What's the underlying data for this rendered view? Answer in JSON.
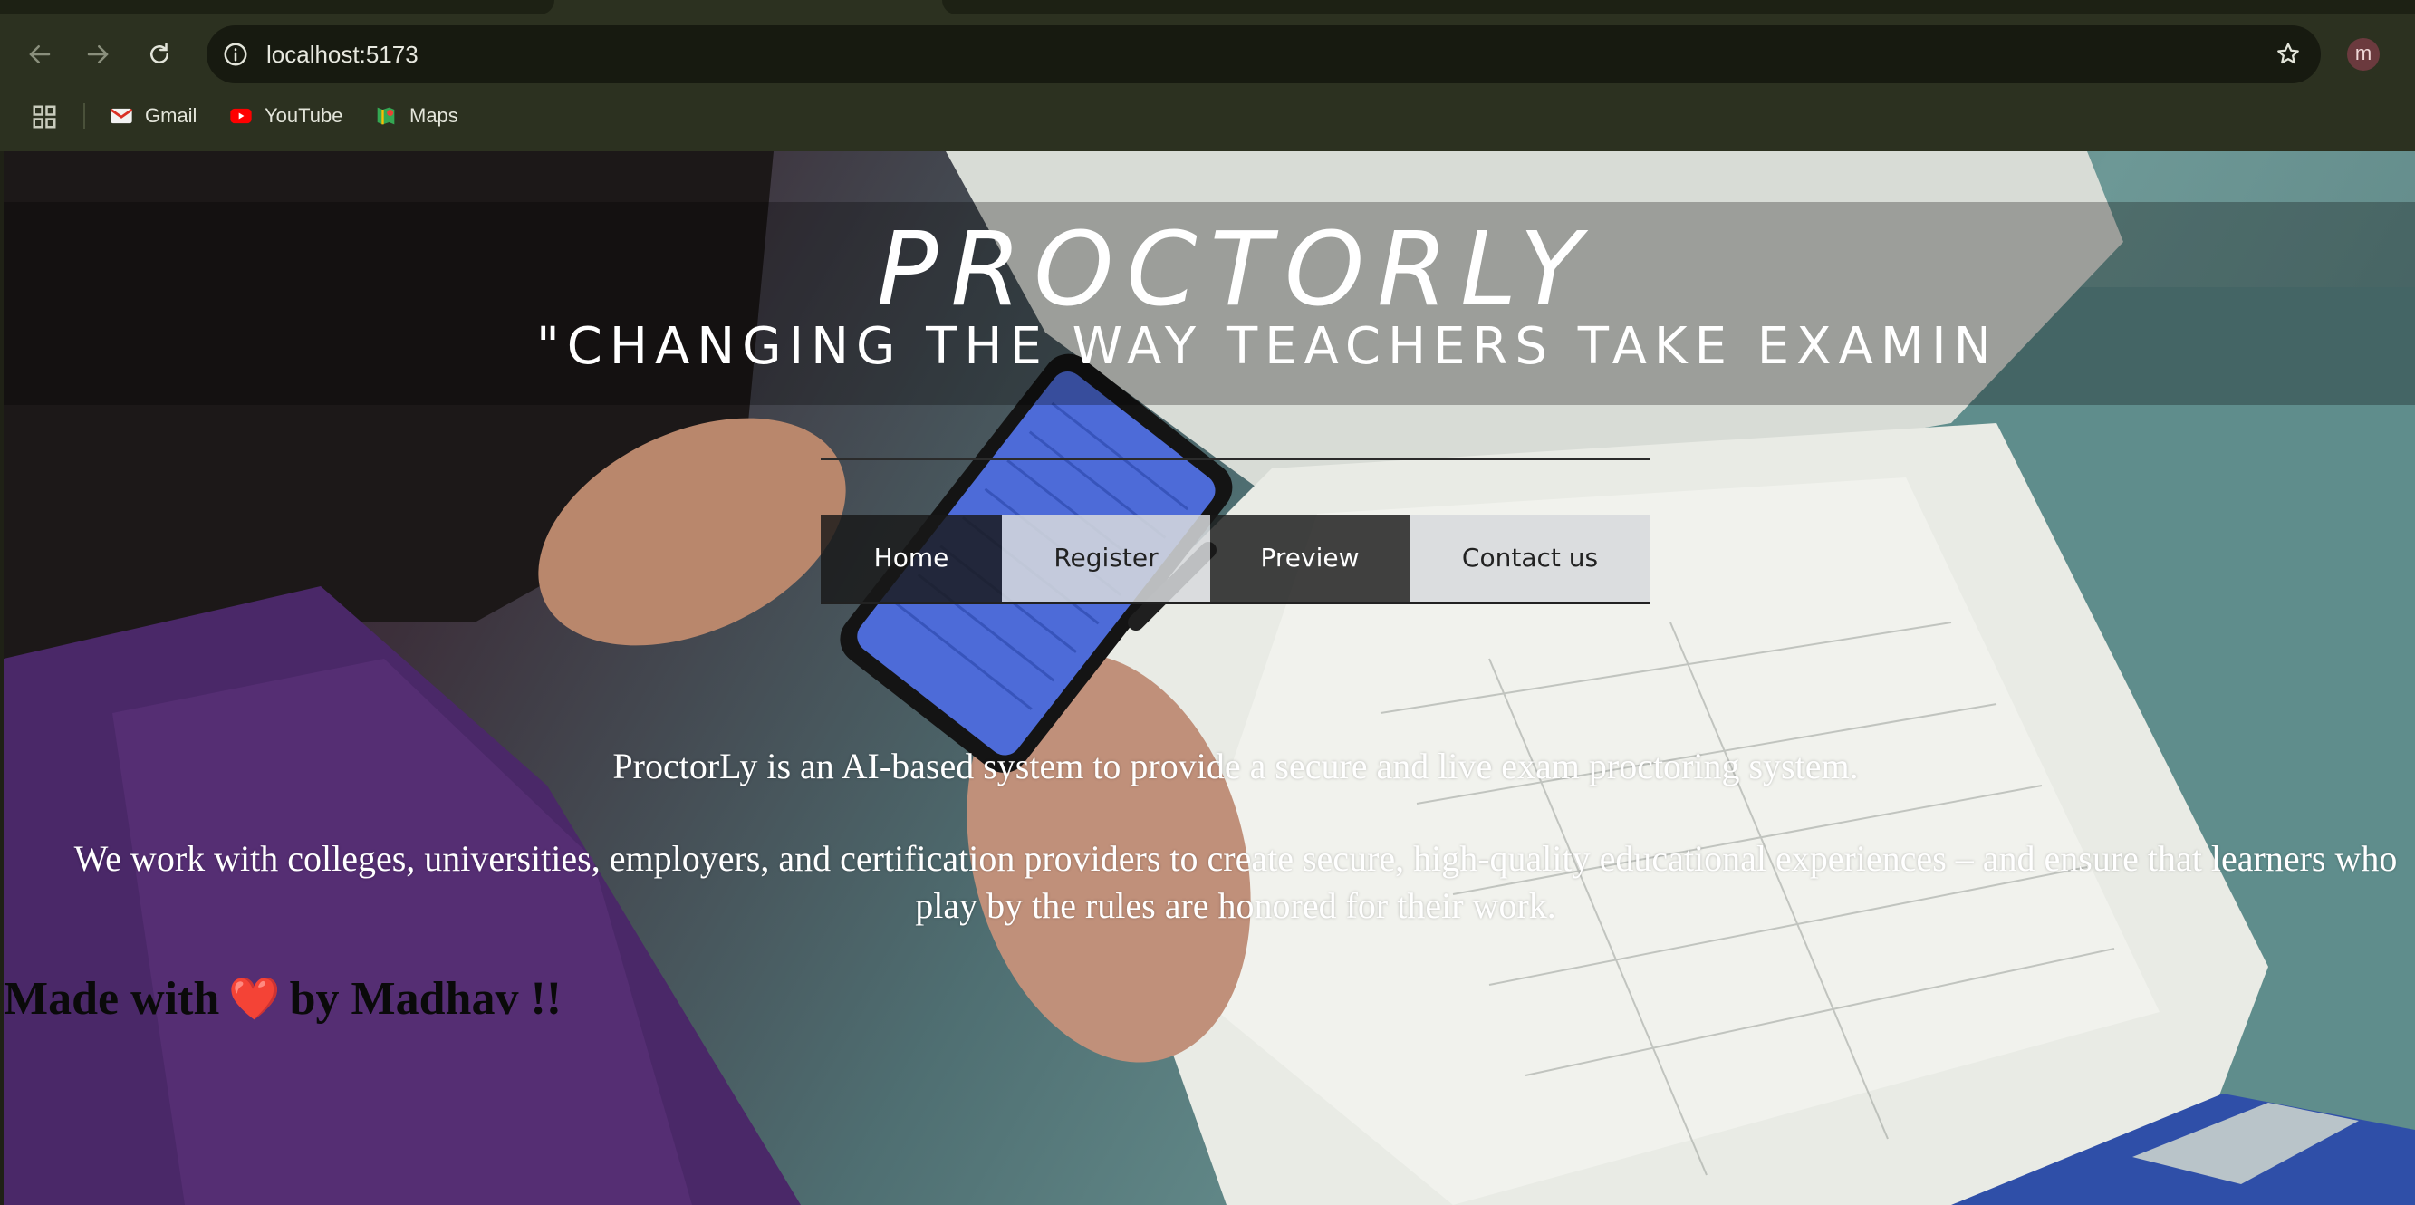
{
  "browser": {
    "url": "localhost:5173",
    "profile_initial": "m",
    "bookmarks": [
      {
        "label": "Gmail",
        "icon": "gmail-icon"
      },
      {
        "label": "YouTube",
        "icon": "youtube-icon"
      },
      {
        "label": "Maps",
        "icon": "maps-icon"
      }
    ]
  },
  "page": {
    "brand": "PROCTORLY",
    "tagline": "\"CHANGING THE WAY TEACHERS TAKE EXAMINATIONS\"",
    "nav": [
      {
        "label": "Home"
      },
      {
        "label": "Register"
      },
      {
        "label": "Preview"
      },
      {
        "label": "Contact us"
      }
    ],
    "intro": "ProctorLy is an AI-based system to provide a secure and live exam proctoring system.",
    "mission": "We work with colleges, universities, employers, and certification providers to create secure, high-quality educational experiences – and ensure that learners who play by the rules are honored for their work.",
    "footer": {
      "prefix": "Made with",
      "heart": "❤️",
      "suffix": "by Madhav !!"
    }
  },
  "colors": {
    "chrome_bg": "#2c3120",
    "omnibox_bg": "#171a10",
    "heart": "#e02424"
  }
}
